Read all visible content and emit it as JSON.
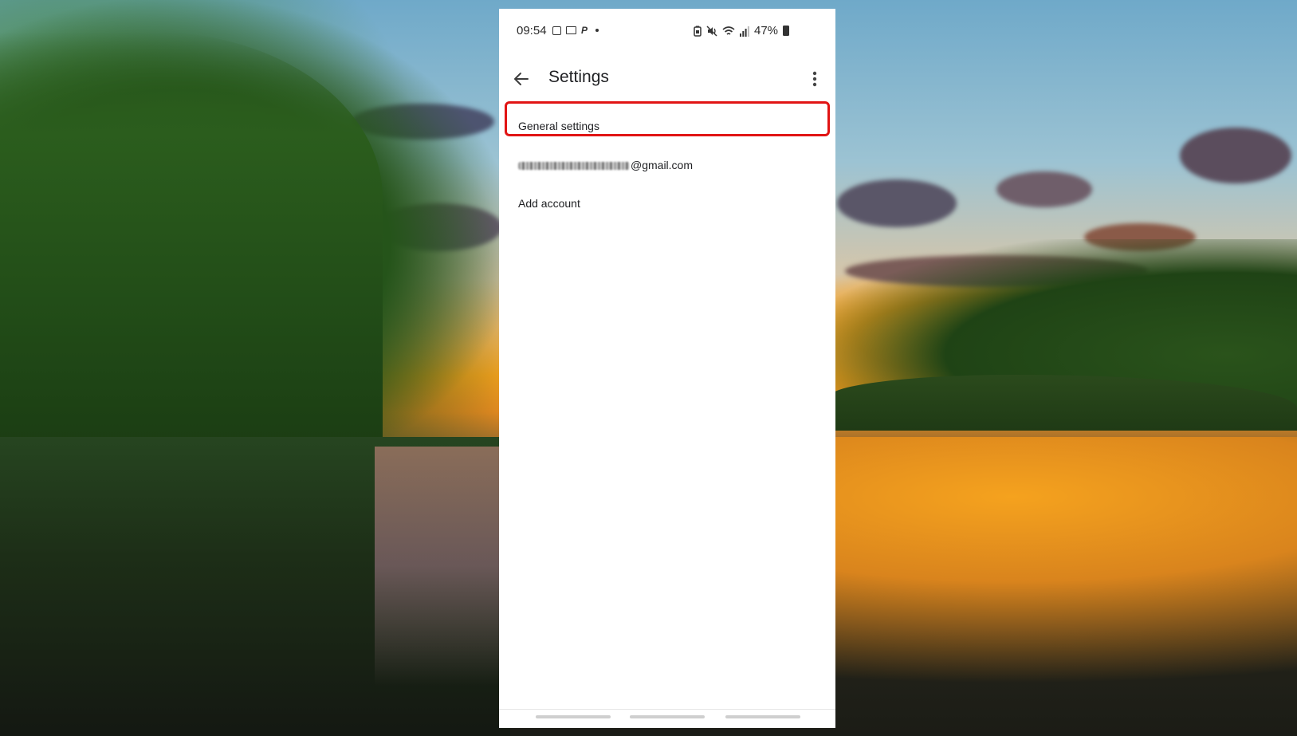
{
  "status_bar": {
    "time": "09:54",
    "battery": "47%",
    "left_icons": [
      "gallery-icon",
      "screen-icon",
      "paypal-icon",
      "dot-icon"
    ],
    "right_icons": [
      "battery-saver-icon",
      "mute-icon",
      "wifi-icon",
      "signal-icon",
      "battery-icon"
    ]
  },
  "app_bar": {
    "title": "Settings",
    "back_icon": "arrow-back-icon",
    "menu_icon": "more-vert-icon"
  },
  "settings_list": {
    "general": "General settings",
    "account_suffix": "@gmail.com",
    "add_account": "Add account"
  },
  "highlight": {
    "target": "General settings",
    "color": "#e11414"
  },
  "nav_bar": {
    "segments": 3
  },
  "colors": {
    "text": "#202124",
    "background": "#ffffff",
    "highlight": "#e11414"
  }
}
